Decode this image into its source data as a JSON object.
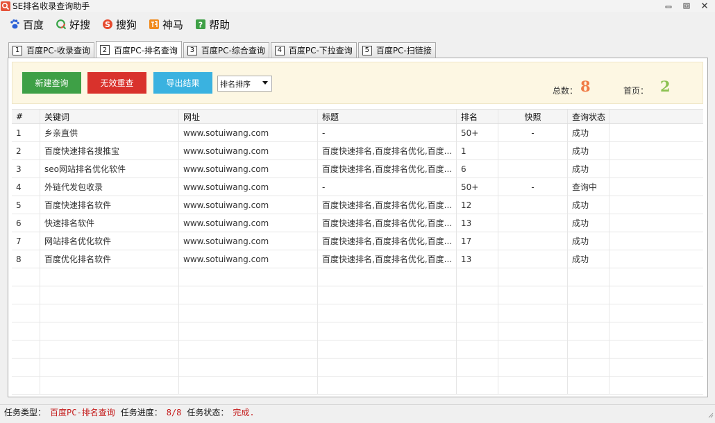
{
  "window": {
    "title": "SE排名收录查询助手",
    "controls": [
      "minimize",
      "restore",
      "close"
    ]
  },
  "menu": [
    {
      "label": "百度",
      "icon": "baidu-paw-icon",
      "color": "#2a5fd6"
    },
    {
      "label": "好搜",
      "icon": "haosou-q-icon",
      "color": "#35a344"
    },
    {
      "label": "搜狗",
      "icon": "sogou-s-icon",
      "color": "#e64a2e"
    },
    {
      "label": "神马",
      "icon": "shenma-icon",
      "color": "#f08a1c"
    },
    {
      "label": "帮助",
      "icon": "help-icon",
      "color": "#3ea046"
    }
  ],
  "tabs": [
    {
      "num": "1",
      "label": "百度PC-收录查询",
      "active": false
    },
    {
      "num": "2",
      "label": "百度PC-排名查询",
      "active": true
    },
    {
      "num": "3",
      "label": "百度PC-综合查询",
      "active": false
    },
    {
      "num": "4",
      "label": "百度PC-下拉查询",
      "active": false
    },
    {
      "num": "5",
      "label": "百度PC-扫链接",
      "active": false
    }
  ],
  "toolbar": {
    "new_query": "新建查询",
    "invalid_requery": "无效重查",
    "export_results": "导出结果",
    "sort_select": "排名排序",
    "total_label": "总数：",
    "total_value": "8",
    "first_page_label": "首页：",
    "first_page_value": "2",
    "colors": {
      "new": "#3ea046",
      "invalid": "#d9322c",
      "export": "#3ab2e0",
      "total": "#f07a45",
      "first_page": "#8cc152"
    }
  },
  "table": {
    "columns": [
      "#",
      "关键词",
      "网址",
      "标题",
      "排名",
      "快照",
      "查询状态",
      ""
    ],
    "rows": [
      [
        "1",
        "乡亲直供",
        "www.sotuiwang.com",
        "-",
        "50+",
        "-",
        "成功",
        ""
      ],
      [
        "2",
        "百度快速排名搜推宝",
        "www.sotuiwang.com",
        "百度快速排名,百度排名优化,百度...",
        "1",
        "",
        "成功",
        ""
      ],
      [
        "3",
        "seo网站排名优化软件",
        "www.sotuiwang.com",
        "百度快速排名,百度排名优化,百度...",
        "6",
        "",
        "成功",
        ""
      ],
      [
        "4",
        "外链代发包收录",
        "www.sotuiwang.com",
        "-",
        "50+",
        "-",
        "查询中",
        ""
      ],
      [
        "5",
        "百度快速排名软件",
        "www.sotuiwang.com",
        "百度快速排名,百度排名优化,百度...",
        "12",
        "",
        "成功",
        ""
      ],
      [
        "6",
        "快速排名软件",
        "www.sotuiwang.com",
        "百度快速排名,百度排名优化,百度...",
        "13",
        "",
        "成功",
        ""
      ],
      [
        "7",
        "网站排名优化软件",
        "www.sotuiwang.com",
        "百度快速排名,百度排名优化,百度...",
        "17",
        "",
        "成功",
        ""
      ],
      [
        "8",
        "百度优化排名软件",
        "www.sotuiwang.com",
        "百度快速排名,百度排名优化,百度...",
        "13",
        "",
        "成功",
        ""
      ]
    ],
    "empty_rows": 7
  },
  "status": {
    "task_type_label": "任务类型：",
    "task_type_value": "百度PC-排名查询",
    "progress_label": "任务进度：",
    "progress_value": "8/8",
    "state_label": "任务状态：",
    "state_value": "完成."
  }
}
